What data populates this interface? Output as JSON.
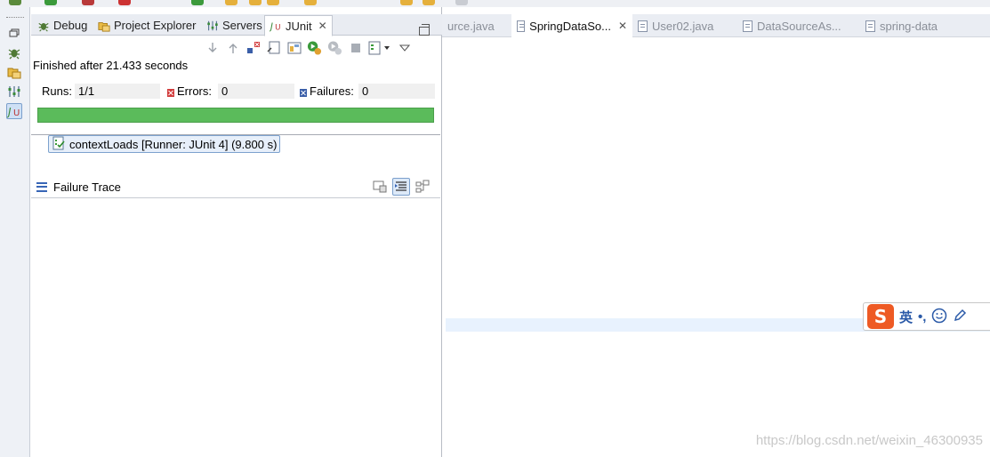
{
  "view": {
    "tabs": [
      {
        "label": "Debug",
        "icon": "debug-icon"
      },
      {
        "label": "Project Explorer",
        "icon": "project-explorer-icon"
      },
      {
        "label": "Servers",
        "icon": "servers-icon"
      },
      {
        "label": "JUnit",
        "icon": "junit-icon",
        "active": true
      }
    ],
    "status": "Finished after 21.433 seconds",
    "counters": {
      "runs_label": "Runs:",
      "runs_value": "1/1",
      "errors_label": "Errors:",
      "errors_value": "0",
      "failures_label": "Failures:",
      "failures_value": "0"
    },
    "progress": {
      "fraction": 1.0,
      "color": "#5bbb5b"
    },
    "test": {
      "label": "contextLoads [Runner: JUnit 4] (9.800 s)"
    },
    "trace": {
      "title": "Failure Trace"
    }
  },
  "editor": {
    "tabs": [
      {
        "label": "urce.java"
      },
      {
        "label": "SpringDataSo...",
        "active": true
      },
      {
        "label": "User02.java"
      },
      {
        "label": "DataSourceAs..."
      },
      {
        "label": "spring-data"
      }
    ]
  },
  "ime": {
    "char": "英",
    "punct": "•,"
  },
  "watermark": "https://blog.csdn.net/weixin_46300935",
  "colors": {
    "accent": "#3866b6",
    "success": "#5bbb5b",
    "error": "#d23d3d"
  }
}
